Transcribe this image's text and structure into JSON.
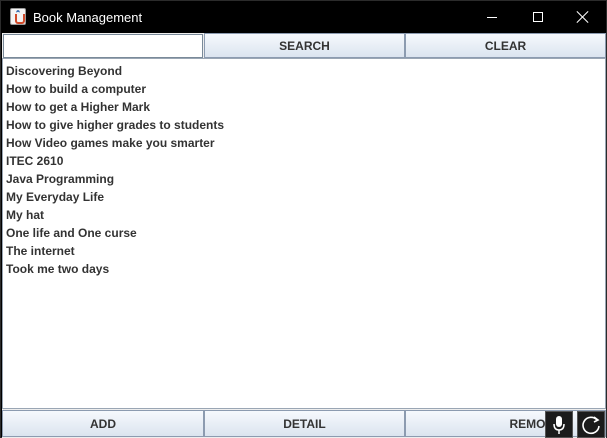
{
  "window": {
    "title": "Book Management"
  },
  "search": {
    "value": "",
    "placeholder": "",
    "search_label": "SEARCH",
    "clear_label": "CLEAR"
  },
  "books": [
    "Discovering Beyond",
    "How to build a computer",
    "How to get a Higher Mark",
    "How to give higher grades to students",
    "How Video games make you smarter",
    "ITEC 2610",
    "Java Programming",
    "My Everyday Life",
    "My hat",
    "One life and One curse",
    "The internet",
    "Took me two days"
  ],
  "actions": {
    "add_label": "ADD",
    "detail_label": "DETAIL",
    "remove_label": "REMOVE"
  },
  "icons": {
    "app": "java-cup-icon",
    "minimize": "minimize-icon",
    "maximize": "maximize-icon",
    "close": "close-icon",
    "mic": "microphone-icon",
    "refresh": "refresh-icon"
  }
}
